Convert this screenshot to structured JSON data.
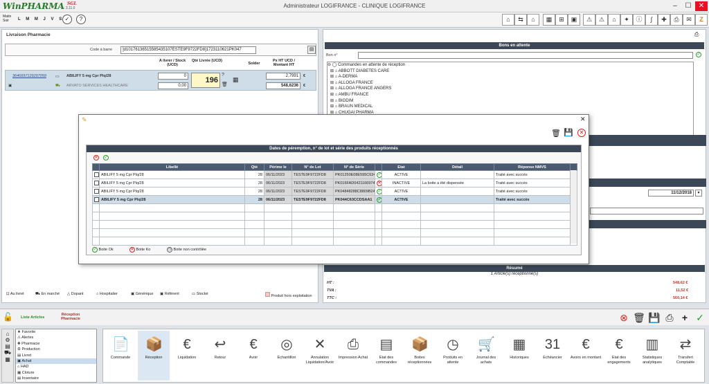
{
  "app": {
    "logo_main": "WinPHARMA",
    "logo_sub": "SGL",
    "version": "v. 3.11.0",
    "title": "Administrateur LOGIFRANCE - CLINIQUE LOGIFRANCE"
  },
  "toolbar": {
    "shift": "Matin Soir",
    "days": "L M M J V S D"
  },
  "left": {
    "section_title": "Livraison Pharmacie",
    "barcode_label": "Code à barre",
    "barcode_value": "]d10176136515585435107ESTE9F9722FD8]1723110621PK047",
    "col_a_livrer": "A livrer / Stock (UCD)",
    "col_qte_livree": "Qté Livrée (UCD)",
    "col_solder": "Solder",
    "col_px": "Px HT UCD / Montant HT",
    "row": {
      "code": "3646697129297059",
      "name": "ABILIFY 5 mg Cpr Plq/28",
      "supplier": "ARVATO SERVICES HEALTHCARE",
      "a_livrer": "0",
      "stock": "0,00",
      "qte": "196",
      "px": "2,7991",
      "montant": "548,6236",
      "cur": "€"
    },
    "legend": [
      "Au livret",
      "En marché",
      "Dopant",
      "Hospitalier",
      "Générique",
      "Référent",
      "Stocké",
      "Produit hors exploitation"
    ]
  },
  "right": {
    "title": "Bons en attente",
    "bon_label": "Bon n°",
    "tree_root": "Commandes en attente de réception",
    "suppliers": [
      "ABBOTT DIABETES CARE",
      "A-DERMA",
      "ALLOGA FRANCE",
      "ALLOGA FRANCE ANGERS",
      "AMBU FRANCE",
      "BIODIM",
      "BRAUN MEDICAL",
      "CHUGAI PHARMA"
    ],
    "date": "11/12/2018",
    "resume_title": "Résumé",
    "resume_sub": "1 Article(s) réceptionné(s)",
    "ht_label": "HT :",
    "ht_value": "548,62 €",
    "tva_label": "TVA :",
    "tva_value": "11,52 €",
    "ttc_label": "TTC :",
    "ttc_value": "560,14 €"
  },
  "modal": {
    "title": "Dates de péremption, n° de lot et série des produits réceptionnés",
    "columns": [
      "Libellé",
      "Qté",
      "Périme le",
      "N° de Lot",
      "N° de Série",
      "Etat",
      "Détail",
      "Réponse NMVS"
    ],
    "rows": [
      {
        "lib": "ABILIFY 5 mg Cpr Plq/28",
        "qte": "28",
        "date": "06/11/2023",
        "lot": "TESTE9F9722FD8",
        "serie": "PK01250E08E595C634",
        "etat": "ACTIVE",
        "detail": "",
        "nmvs": "Traité avec succès",
        "status": "ok"
      },
      {
        "lib": "ABILIFY 5 mg Cpr Plq/28",
        "qte": "28",
        "date": "06/11/2023",
        "lot": "TESTE9F9722FD8",
        "serie": "PK016FAD0421166974",
        "etat": "INACTIVE",
        "detail": "La boite a été dispensée",
        "nmvs": "Traité avec succès",
        "status": "ko"
      },
      {
        "lib": "ABILIFY 5 mg Cpr Plq/28",
        "qte": "28",
        "date": "06/11/2023",
        "lot": "TESTE9F9722FD8",
        "serie": "PK04848288C8809B24",
        "etat": "ACTIVE",
        "detail": "",
        "nmvs": "Traité avec succès",
        "status": "ok"
      },
      {
        "lib": "ABILIFY 5 mg Cpr Plq/28",
        "qte": "28",
        "date": "06/11/2023",
        "lot": "TESTE9F9722FD8",
        "serie": "PK044C63CCDSAA1",
        "etat": "ACTIVE",
        "detail": "",
        "nmvs": "Traité avec succès",
        "status": "ok"
      }
    ],
    "legend_ok": "Boite Ok",
    "legend_ko": "Boite Ko",
    "legend_nc": "Boite non contrôlée"
  },
  "bottom": {
    "tab_articles": "Liste Articles",
    "tab_reception": "Réception Pharmacie",
    "menu": [
      "Favorite",
      "Alertes",
      "Pharmacie",
      "Production",
      "Livret",
      "Achat",
      "HAD",
      "Cloture",
      "Inventaire"
    ],
    "menu_selected": "Achat",
    "buttons": [
      "Commande",
      "Réception",
      "Liquidation",
      "Retour",
      "Avoir",
      "Echantillon",
      "Annulation Liquidation/Avoir",
      "Impression Achat",
      "Etat des commandes",
      "Boites réceptionnées",
      "Produits en attente",
      "Journal des achats",
      "Historiques",
      "Echéancier",
      "Avoirs en montant",
      "Etat des engagements",
      "Statistiques analytiques",
      "Transfert Comptable"
    ]
  }
}
